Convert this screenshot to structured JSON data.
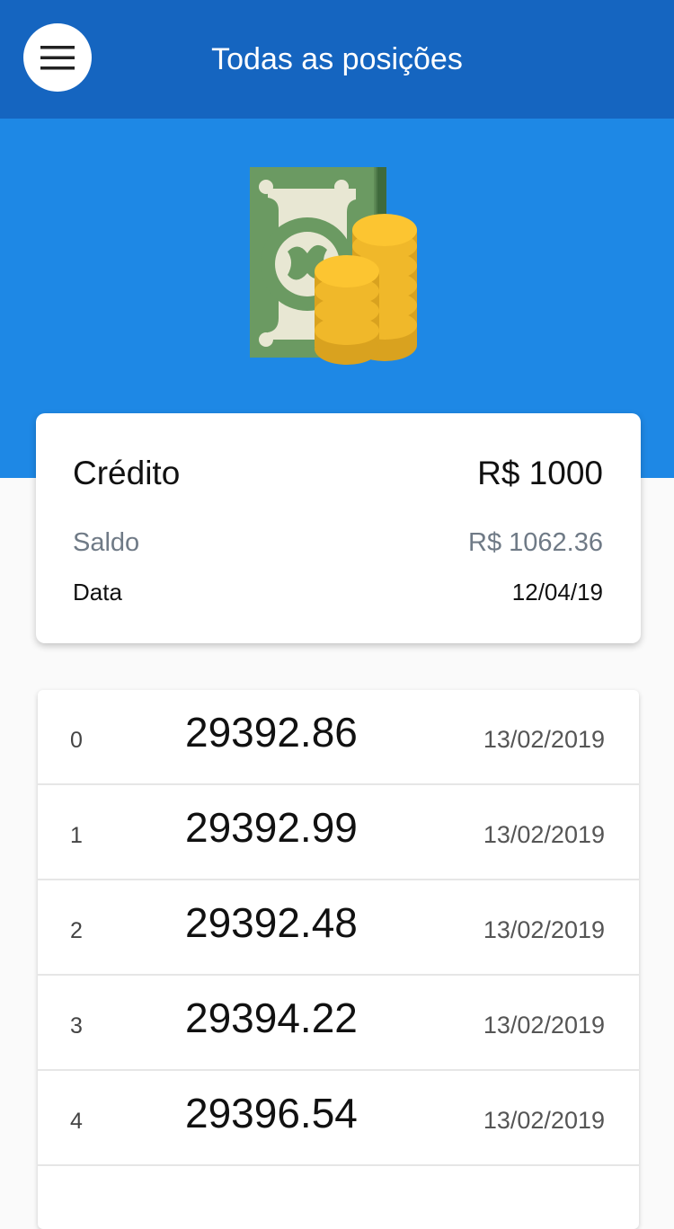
{
  "appbar": {
    "title": "Todas as posições",
    "menu_icon": "hamburger-menu-icon"
  },
  "hero": {
    "illustration": "money-stack-coins-icon"
  },
  "summary": {
    "credit_label": "Crédito",
    "credit_value": "R$ 1000",
    "balance_label": "Saldo",
    "balance_value": "R$ 1062.36",
    "date_label": "Data",
    "date_value": "12/04/19"
  },
  "positions": [
    {
      "index": "0",
      "value": "29392.86",
      "date": "13/02/2019"
    },
    {
      "index": "1",
      "value": "29392.99",
      "date": "13/02/2019"
    },
    {
      "index": "2",
      "value": "29392.48",
      "date": "13/02/2019"
    },
    {
      "index": "3",
      "value": "29394.22",
      "date": "13/02/2019"
    },
    {
      "index": "4",
      "value": "29396.54",
      "date": "13/02/2019"
    }
  ],
  "colors": {
    "appbar": "#1565c0",
    "hero": "#1e88e5",
    "background": "#fafafa",
    "balance_text": "#6f7a86"
  }
}
